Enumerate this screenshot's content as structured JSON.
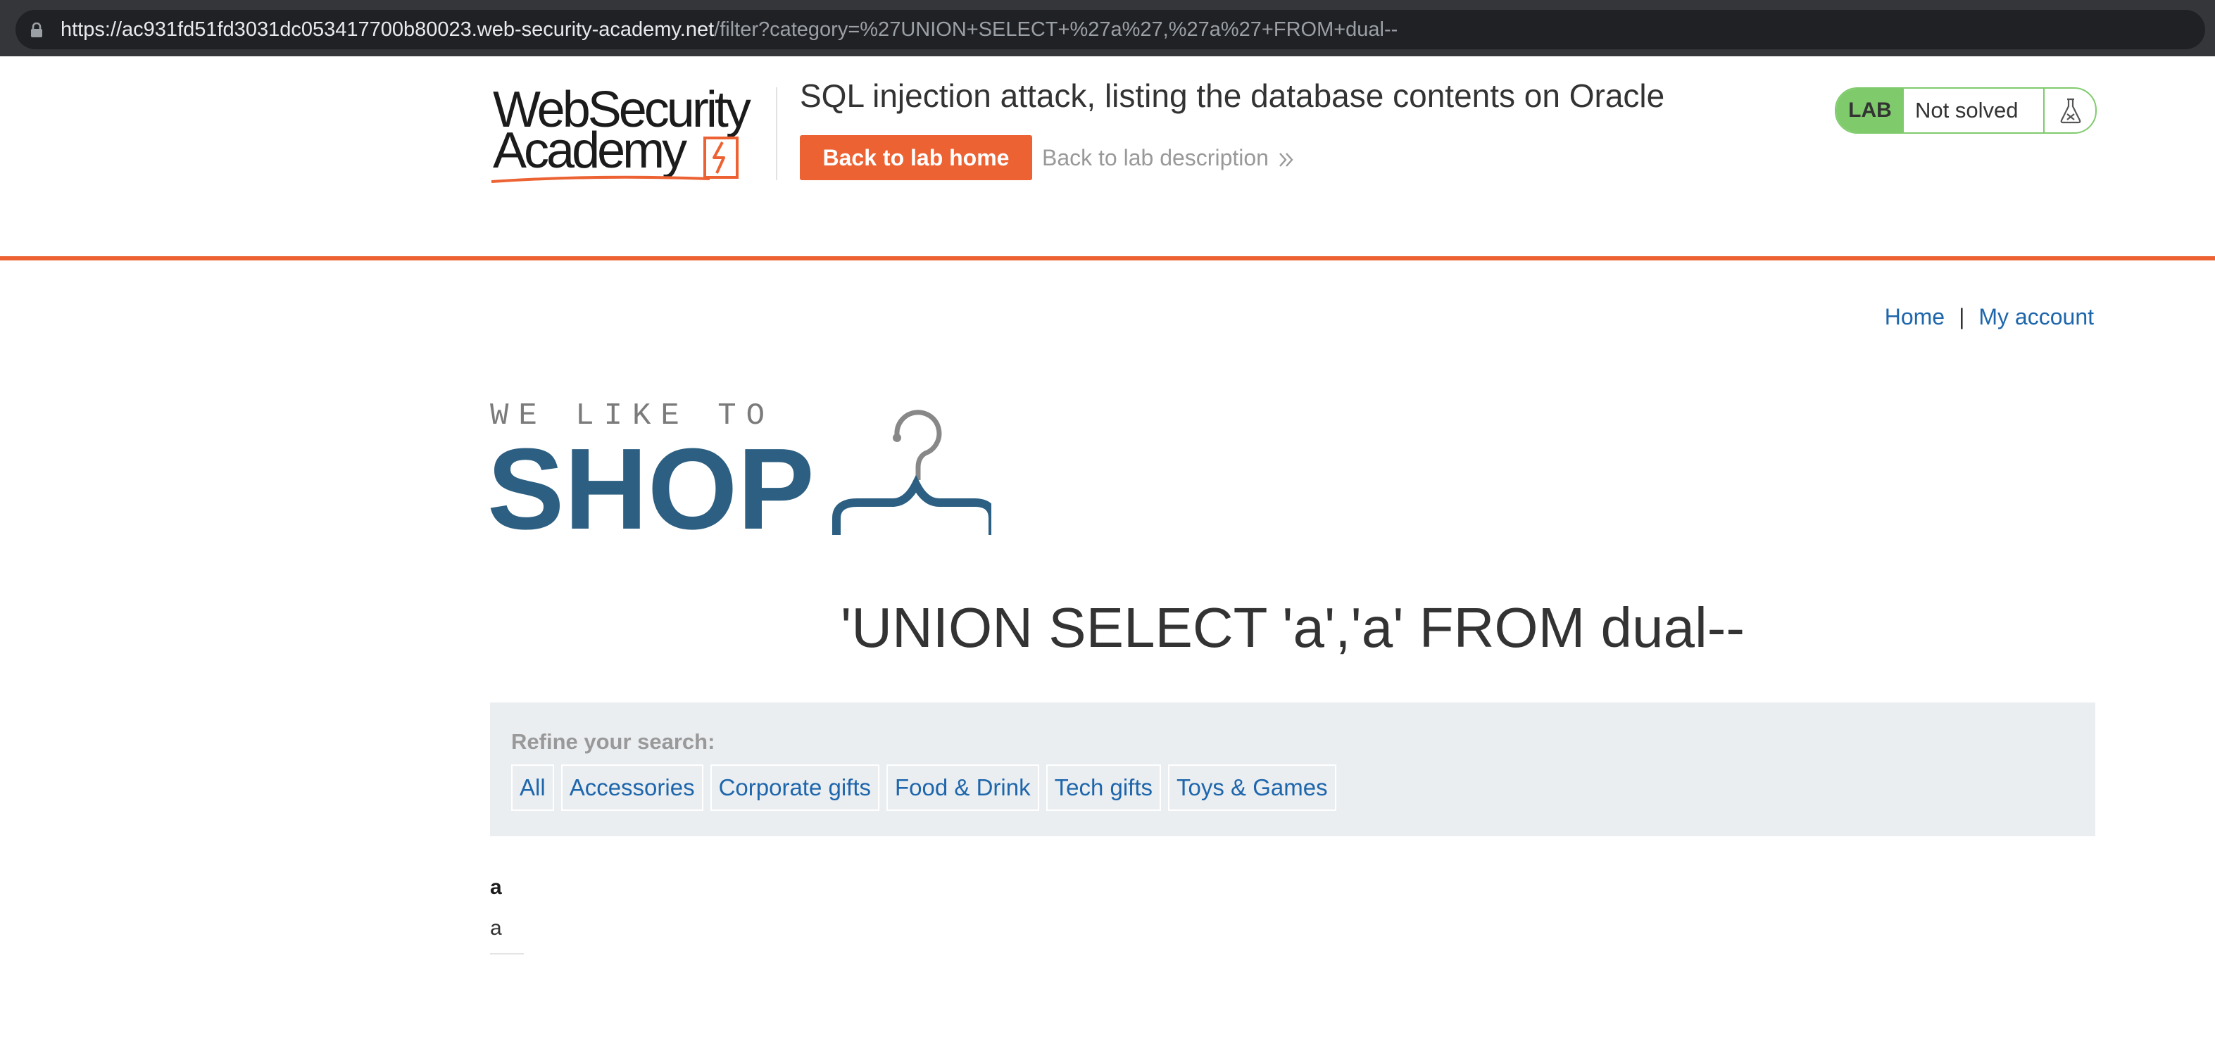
{
  "browser": {
    "url_host": "https://ac931fd51fd3031dc053417700b80023.web-security-academy.net",
    "url_rest": "/filter?category=%27UNION+SELECT+%27a%27,%27a%27+FROM+dual--"
  },
  "lab_header": {
    "logo": {
      "line1": "WebSecurity",
      "line2": "Academy"
    },
    "title": "SQL injection attack, listing the database contents on Oracle",
    "back_home_label": "Back to lab home",
    "back_description_label": "Back to lab description",
    "status_tag": "LAB",
    "status_text": "Not solved"
  },
  "nav": {
    "home_label": "Home",
    "separator": "|",
    "account_label": "My account"
  },
  "shop_logo": {
    "tagline": "WE LIKE TO",
    "word": "SHOP"
  },
  "search": {
    "heading": "'UNION SELECT 'a','a' FROM dual--"
  },
  "filter": {
    "label": "Refine your search:",
    "categories": [
      "All",
      "Accessories",
      "Corporate gifts",
      "Food & Drink",
      "Tech gifts",
      "Toys & Games"
    ]
  },
  "results": {
    "header": "a",
    "cell": "a"
  },
  "colors": {
    "accent": "#ec6233",
    "lab_green": "#7fcb6c",
    "link_blue": "#1e66ac",
    "shop_blue": "#2c5f82",
    "filter_bg": "#ebeef1"
  }
}
